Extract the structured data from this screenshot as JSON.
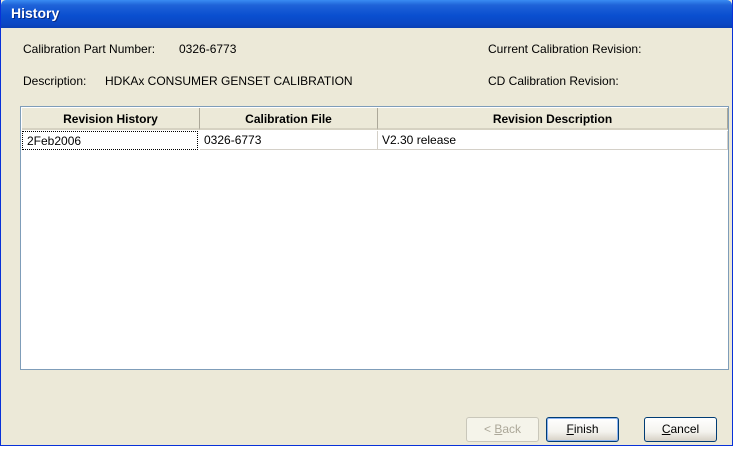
{
  "window": {
    "title": "History"
  },
  "info": {
    "part_number_label": "Calibration Part Number:",
    "part_number_value": "0326-6773",
    "current_revision_label": "Current Calibration Revision:",
    "description_label": "Description:",
    "description_value": "HDKAx CONSUMER GENSET CALIBRATION",
    "cd_revision_label": "CD Calibration Revision:"
  },
  "table": {
    "columns": [
      "Revision History",
      "Calibration File",
      "Revision Description"
    ],
    "rows": [
      [
        "2Feb2006",
        "0326-6773",
        "V2.30 release"
      ]
    ]
  },
  "buttons": {
    "back_prefix": "< ",
    "back_key": "B",
    "back_rest": "ack",
    "finish_key": "F",
    "finish_rest": "inish",
    "cancel_key": "C",
    "cancel_rest": "ancel"
  }
}
